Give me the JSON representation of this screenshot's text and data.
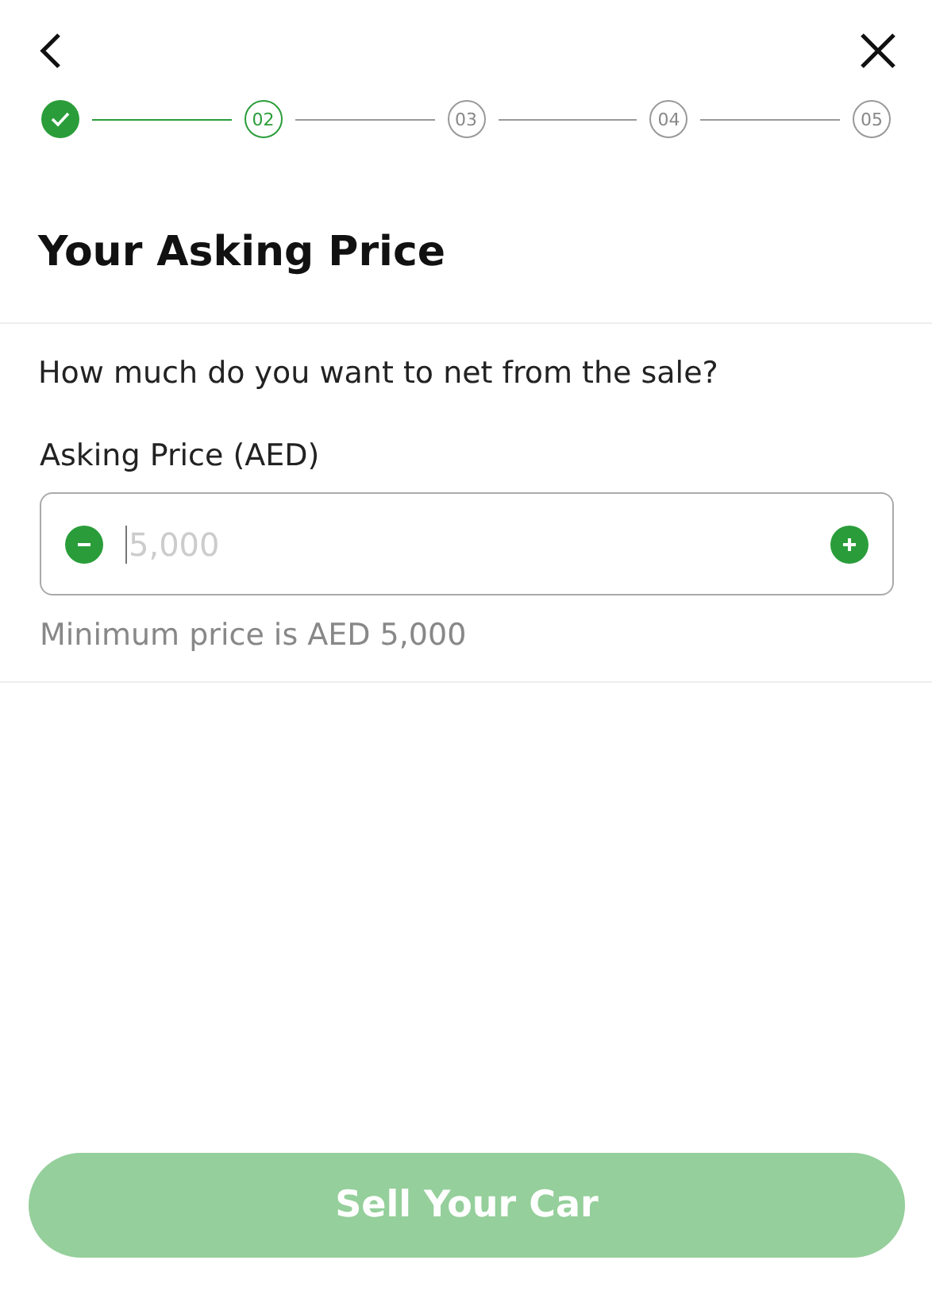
{
  "steps": [
    {
      "completed": true,
      "selected": false
    },
    {
      "label": "02",
      "completed": false,
      "selected": true
    },
    {
      "label": "03",
      "completed": false,
      "selected": false
    },
    {
      "label": "04",
      "completed": false,
      "selected": false
    },
    {
      "label": "05",
      "completed": false,
      "selected": false
    }
  ],
  "title": "Your Asking Price",
  "question": "How much do you want to net from the sale?",
  "field": {
    "label": "Asking Price (AED)",
    "placeholder": "5,000",
    "hint": "Minimum price is AED 5,000"
  },
  "submit": {
    "label": "Sell Your Car",
    "disabled": true
  }
}
